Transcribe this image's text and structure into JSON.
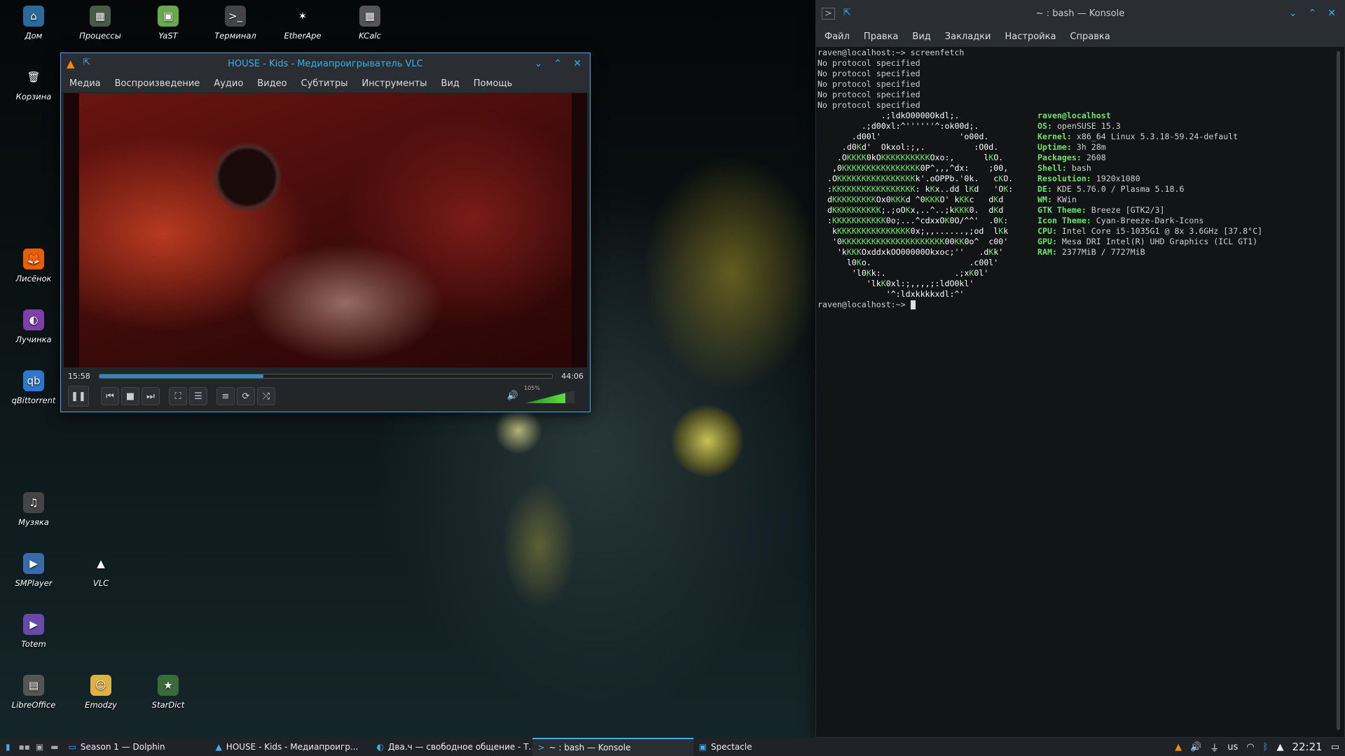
{
  "desktop": {
    "icons_col1": [
      {
        "label": "Дом",
        "icon": "home-folder-icon",
        "glyph": "⌂",
        "bg": "#2b6a9a"
      },
      {
        "label": "Корзина",
        "icon": "trash-icon",
        "glyph": "🗑",
        "bg": "transparent"
      },
      {
        "label": "Лисёнок",
        "icon": "firefox-icon",
        "glyph": "🦊",
        "bg": "#e66000"
      },
      {
        "label": "Лучинка",
        "icon": "tor-browser-icon",
        "glyph": "◐",
        "bg": "#7e3fa8"
      },
      {
        "label": "qBittorrent",
        "icon": "qbittorrent-icon",
        "glyph": "qb",
        "bg": "#2f77c8"
      },
      {
        "label": "Музяка",
        "icon": "music-player-icon",
        "glyph": "♫",
        "bg": "#444"
      },
      {
        "label": "SMPlayer",
        "icon": "smplayer-icon",
        "glyph": "▶",
        "bg": "#3a6aa8"
      },
      {
        "label": "Totem",
        "icon": "totem-icon",
        "glyph": "▶",
        "bg": "#6a4aa8"
      },
      {
        "label": "LibreOffice",
        "icon": "libreoffice-icon",
        "glyph": "▤",
        "bg": "#555"
      }
    ],
    "icons_row1": [
      {
        "label": "Процессы",
        "icon": "system-monitor-icon",
        "glyph": "▦",
        "bg": "#4a5a4a"
      },
      {
        "label": "YaST",
        "icon": "yast-icon",
        "glyph": "▣",
        "bg": "#6aa84f"
      },
      {
        "label": "Терминал",
        "icon": "terminal-icon",
        "glyph": ">_",
        "bg": "#444"
      },
      {
        "label": "EtherApe",
        "icon": "etherape-icon",
        "glyph": "✶",
        "bg": "transparent"
      },
      {
        "label": "KCalc",
        "icon": "kcalc-icon",
        "glyph": "▦",
        "bg": "#555"
      }
    ],
    "icons_col2": [
      {
        "label": "VLC",
        "icon": "vlc-icon",
        "glyph": "▲",
        "bg": "transparent"
      },
      {
        "label": "Emodzy",
        "icon": "emoji-app-icon",
        "glyph": "☺",
        "bg": "#e0b040"
      },
      {
        "label": "StarDict",
        "icon": "stardict-icon",
        "glyph": "★",
        "bg": "#3a6a3a"
      }
    ]
  },
  "vlc": {
    "title": "HOUSE - Kids - Медиапроигрыватель VLC",
    "menu": [
      "Медиа",
      "Воспроизведение",
      "Аудио",
      "Видео",
      "Субтитры",
      "Инструменты",
      "Вид",
      "Помощь"
    ],
    "time_elapsed": "15:58",
    "time_total": "44:06",
    "progress_fraction": 0.362,
    "volume_label": "105%",
    "volume_fraction": 0.82
  },
  "konsole": {
    "title": "~ : bash — Konsole",
    "menu": [
      "Файл",
      "Правка",
      "Вид",
      "Закладки",
      "Настройка",
      "Справка"
    ],
    "lines": [
      "raven@localhost:~> screenfetch",
      "No protocol specified",
      "No protocol specified",
      "No protocol specified",
      "No protocol specified",
      "No protocol specified"
    ],
    "logo": [
      "             .;ldkO0000Okdl;.",
      "         .;d00xl:^''''''^:ok00d;.",
      "       .d00l'                'o00d.",
      "     .d0Kd'  Okxol:;,.          :O0d.",
      "    .OKKKK0kOKKKKKKKKKKOxo:,      lKO.",
      "   ,0KKKKKKKKKKKKKKKK0P^,,,^dx:    ;00,",
      "  .OKKKKKKKKKKKKKKKKk'.oOPPb.'0k.   cKO.",
      "  :KKKKKKKKKKKKKKKKK: kKx..dd lKd   'OK:",
      "  dKKKKKKKKKOx0KKKd ^0KKKO' kKKc   dKd",
      "  dKKKKKKKKKK;.;oOKx,..^..;kKKK0.  dKd",
      "  :KKKKKKKKKKK0o;...^cdxxOK0O/^^'  .0K:",
      "   kKKKKKKKKKKKKKKK0x;,,......,;od  lKk",
      "   '0KKKKKKKKKKKKKKKKKKKKK00KK0o^  c00'",
      "    'kKKKOxddxkOO00000Okxoc;''   .dKk'",
      "      l0Ko.                    .c00l'",
      "       'l0Kk:.              .;xK0l'",
      "          'lkK0xl:;,,,,;:ldO0kl'",
      "              '^:ldxkkkkxdl:^'"
    ],
    "info": [
      {
        "k": "",
        "v": "raven@localhost"
      },
      {
        "k": "OS:",
        "v": "openSUSE 15.3"
      },
      {
        "k": "Kernel:",
        "v": "x86_64 Linux 5.3.18-59.24-default"
      },
      {
        "k": "Uptime:",
        "v": "3h 28m"
      },
      {
        "k": "Packages:",
        "v": "2608"
      },
      {
        "k": "Shell:",
        "v": "bash"
      },
      {
        "k": "Resolution:",
        "v": "1920x1080"
      },
      {
        "k": "DE:",
        "v": "KDE 5.76.0 / Plasma 5.18.6"
      },
      {
        "k": "WM:",
        "v": "KWin"
      },
      {
        "k": "GTK Theme:",
        "v": "Breeze [GTK2/3]"
      },
      {
        "k": "Icon Theme:",
        "v": "Cyan-Breeze-Dark-Icons"
      },
      {
        "k": "CPU:",
        "v": "Intel Core i5-1035G1 @ 8x 3.6GHz [37.8°C]"
      },
      {
        "k": "GPU:",
        "v": "Mesa DRI Intel(R) UHD Graphics (ICL GT1)"
      },
      {
        "k": "RAM:",
        "v": "2377MiB / 7727MiB"
      }
    ],
    "prompt": "raven@localhost:~> "
  },
  "taskbar": {
    "tasks": [
      {
        "label": "Season 1 — Dolphin",
        "icon": "dolphin-icon",
        "glyph": "▭",
        "active": false
      },
      {
        "label": "HOUSE - Kids - Медиапроигр...",
        "icon": "vlc-icon",
        "glyph": "▲",
        "active": false
      },
      {
        "label": "Два.ч — свободное общение - Т...",
        "icon": "tor-browser-icon",
        "glyph": "◐",
        "active": false
      },
      {
        "label": "~ : bash — Konsole",
        "icon": "konsole-icon",
        "glyph": ">",
        "active": true
      },
      {
        "label": "Spectacle",
        "icon": "spectacle-icon",
        "glyph": "▣",
        "active": false
      }
    ],
    "keyboard_layout": "us",
    "clock": "22:21"
  },
  "colors": {
    "accent": "#3daee9",
    "terminal_green": "#6fe36f"
  }
}
